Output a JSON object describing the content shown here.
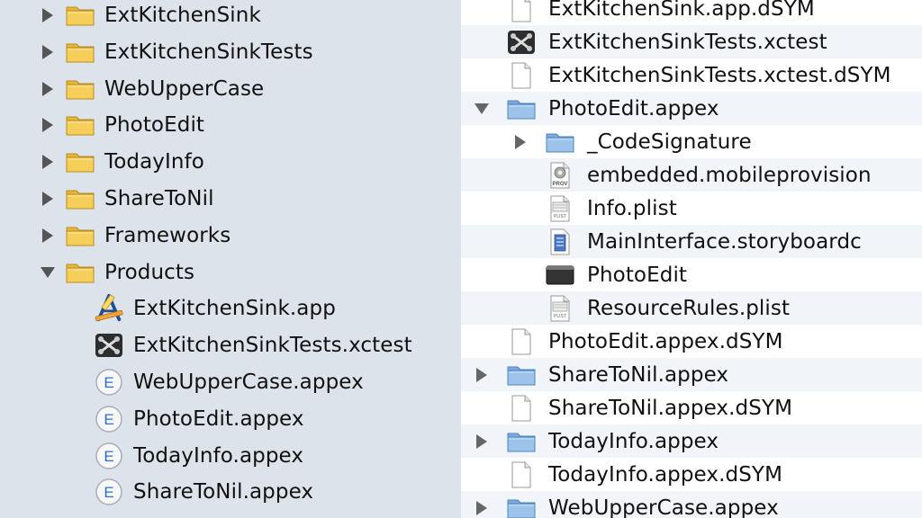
{
  "navigator": {
    "rows": [
      {
        "label": "ExtKitchenSink",
        "icon": "folder-icon",
        "disclosure": "collapsed"
      },
      {
        "label": "ExtKitchenSinkTests",
        "icon": "folder-icon",
        "disclosure": "collapsed"
      },
      {
        "label": "WebUpperCase",
        "icon": "folder-icon",
        "disclosure": "collapsed"
      },
      {
        "label": "PhotoEdit",
        "icon": "folder-icon",
        "disclosure": "collapsed"
      },
      {
        "label": "TodayInfo",
        "icon": "folder-icon",
        "disclosure": "collapsed"
      },
      {
        "label": "ShareToNil",
        "icon": "folder-icon",
        "disclosure": "collapsed"
      },
      {
        "label": "Frameworks",
        "icon": "folder-icon",
        "disclosure": "collapsed"
      },
      {
        "label": "Products",
        "icon": "folder-icon",
        "disclosure": "expanded"
      },
      {
        "label": "ExtKitchenSink.app",
        "icon": "app-icon",
        "disclosure": "none"
      },
      {
        "label": "ExtKitchenSinkTests.xctest",
        "icon": "xctest-bundle-icon",
        "disclosure": "none"
      },
      {
        "label": "WebUpperCase.appex",
        "icon": "extension-icon",
        "disclosure": "none"
      },
      {
        "label": "PhotoEdit.appex",
        "icon": "extension-icon",
        "disclosure": "none"
      },
      {
        "label": "TodayInfo.appex",
        "icon": "extension-icon",
        "disclosure": "none"
      },
      {
        "label": "ShareToNil.appex",
        "icon": "extension-icon",
        "disclosure": "none"
      }
    ]
  },
  "finder": {
    "rows": [
      {
        "label": "ExtKitchenSink.app.dSYM",
        "icon": "document-icon",
        "disclosure": "none"
      },
      {
        "label": "ExtKitchenSinkTests.xctest",
        "icon": "xctest-bundle-icon",
        "disclosure": "none"
      },
      {
        "label": "ExtKitchenSinkTests.xctest.dSYM",
        "icon": "document-icon",
        "disclosure": "none"
      },
      {
        "label": "PhotoEdit.appex",
        "icon": "blue-folder-icon",
        "disclosure": "expanded"
      },
      {
        "label": "_CodeSignature",
        "icon": "blue-folder-icon",
        "disclosure": "collapsed"
      },
      {
        "label": "embedded.mobileprovision",
        "icon": "provisioning-profile-icon",
        "disclosure": "none",
        "badge": "PROV"
      },
      {
        "label": "Info.plist",
        "icon": "plist-file-icon",
        "disclosure": "none",
        "badge": "PLIST"
      },
      {
        "label": "MainInterface.storyboardc",
        "icon": "storyboard-icon",
        "disclosure": "none"
      },
      {
        "label": "PhotoEdit",
        "icon": "executable-icon",
        "disclosure": "none"
      },
      {
        "label": "ResourceRules.plist",
        "icon": "plist-file-icon",
        "disclosure": "none",
        "badge": "PLIST"
      },
      {
        "label": "PhotoEdit.appex.dSYM",
        "icon": "document-icon",
        "disclosure": "none"
      },
      {
        "label": "ShareToNil.appex",
        "icon": "blue-folder-icon",
        "disclosure": "collapsed"
      },
      {
        "label": "ShareToNil.appex.dSYM",
        "icon": "document-icon",
        "disclosure": "none"
      },
      {
        "label": "TodayInfo.appex",
        "icon": "blue-folder-icon",
        "disclosure": "collapsed"
      },
      {
        "label": "TodayInfo.appex.dSYM",
        "icon": "document-icon",
        "disclosure": "none"
      },
      {
        "label": "WebUpperCase.appex",
        "icon": "blue-folder-icon",
        "disclosure": "collapsed"
      }
    ]
  }
}
